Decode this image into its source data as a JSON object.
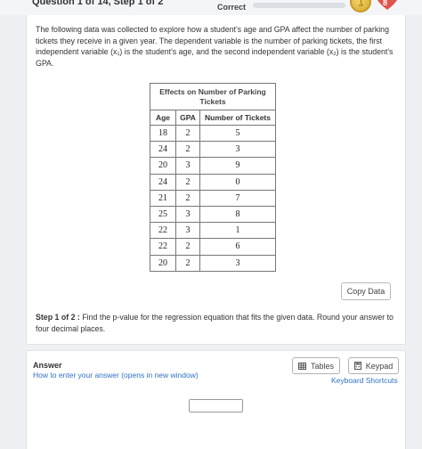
{
  "header": {
    "question_label": "Question 1 of 14, Step 1 of 2",
    "status": "Correct",
    "progress_fraction": 0.0,
    "hearts_count": "8"
  },
  "problem": {
    "intro": "The following data was collected to explore how a student's age and GPA affect the number of parking tickets they receive in a given year. The dependent variable is the number of parking tickets, the first independent variable (x₁) is the student's age, and the second independent variable (x₂) is the student's GPA.",
    "table": {
      "caption": "Effects on Number of Parking Tickets",
      "headers": [
        "Age",
        "GPA",
        "Number of Tickets"
      ],
      "rows": [
        [
          "18",
          "2",
          "5"
        ],
        [
          "24",
          "2",
          "3"
        ],
        [
          "20",
          "3",
          "9"
        ],
        [
          "24",
          "2",
          "0"
        ],
        [
          "21",
          "2",
          "7"
        ],
        [
          "25",
          "3",
          "8"
        ],
        [
          "22",
          "3",
          "1"
        ],
        [
          "22",
          "2",
          "6"
        ],
        [
          "20",
          "2",
          "3"
        ]
      ]
    },
    "copy_button": "Copy Data",
    "step_label": "Step 1 of 2 :",
    "step_text": "Find the p-value for the regression equation that fits the given data. Round your answer to four decimal places."
  },
  "answer": {
    "title": "Answer",
    "help_link": "How to enter your answer (opens in new window)",
    "tables_button": "Tables",
    "keypad_button": "Keypad",
    "shortcuts_link": "Keyboard Shortcuts",
    "input_value": ""
  },
  "icons": {
    "coin": "coin-icon",
    "heart": "heart-icon",
    "tables": "table-icon",
    "keypad": "calculator-icon"
  },
  "colors": {
    "link": "#2f72c4",
    "heart": "#e0544b",
    "coin": "#d4a92d"
  }
}
